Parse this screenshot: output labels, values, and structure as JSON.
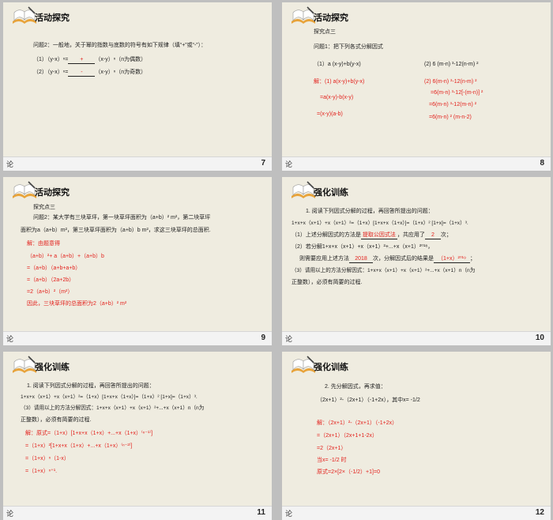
{
  "footer_left": "论",
  "slides": [
    {
      "num": "7",
      "title": "活动探究",
      "q": "问题2：一般地，关于幂的指数与底数的符号有如下规律（填“+”或“-”）：",
      "l1_a": "（1）（y-x）ⁿ=",
      "l1_blank": "+",
      "l1_b": "（x-y）ⁿ（n为偶数）",
      "l2_a": "（2）（y-x）ⁿ=",
      "l2_blank": "-",
      "l2_b": "（x-y）ⁿ（n为奇数）"
    },
    {
      "num": "8",
      "title": "活动探究",
      "sub": "探究点三",
      "q": "问题1：把下列各式分解因式",
      "p1": "（1）a (x-y)+b(y-x)",
      "p2": "(2) 6 (m-n) ³-12(n-m) ²",
      "s1a": "解：(1) a(x-y)+b(y-x)",
      "s1b": "=a(x-y)-b(x-y)",
      "s1c": "=(x-y)(a-b)",
      "s2a": "(2)  6(m-n) ³-12(n-m) ²",
      "s2b": "=6(m-n) ³-12[-(m-n)] ²",
      "s2c": "=6(m-n) ³-12(m-n) ²",
      "s2d": "=6(m-n) ² (m-n-2)"
    },
    {
      "num": "9",
      "title": "活动探究",
      "sub": "探究点三",
      "q1": "问题2：某大学有三块草坪，第一块草坪面积为（a+b）² m²，第二块草坪",
      "q2": "面积为a（a+b）m²，第三块草坪面积为（a+b）b  m²，求这三块草坪的总面积.",
      "s1": "解：由题意得",
      "s2": "（a+b）²+ a（a+b）+（a+b）b",
      "s3": "=（a+b）（a+b+a+b）",
      "s4": "=（a+b）（2a+2b）",
      "s5": "=2（a+b）²（m²）",
      "s6": "因此，三块草坪的总面积为2（a+b）²  m²"
    },
    {
      "num": "10",
      "title": "强化训练",
      "q": "1. 阅读下列因式分解的过程，再回答所提出的问题：",
      "e": "1+x+x（x+1）+x（x+1）²=（1+x）[1+x+x（1+x）]=（1+x）² [1+x]=（1+x）³.",
      "a1_a": "（1）上述分解因式的方法是",
      "a1_blank": "提取公因式法",
      "a1_b": "，共应用了",
      "a1_blank2": "2",
      "a1_c": "次；",
      "a2_a": "（2）若分解1+x+x（x+1）+x（x+1）²+...+x（x+1）²⁰¹⁸，",
      "a2_b": "则需要应用上述方法",
      "a2_blank": "2018",
      "a2_c": "次，分解因式后的结果是",
      "a2_blank2": "（1+x）²⁰¹⁹",
      "a2_d": "；",
      "a3": "（3）请用以上的方法分解因式：1+x+x（x+1）+x（x+1）²+...+x（x+1）n（n为",
      "a3b": "正整数），必须有简要的过程."
    },
    {
      "num": "11",
      "title": "强化训练",
      "q": "1. 阅读下列因式分解的过程，再回答所提出的问题：",
      "e": "1+x+x（x+1）+x（x+1）²=（1+x）[1+x+x（1+x）]=（1+x）² [1+x]=（1+x）³.",
      "a3": "（3）请用以上的方法分解因式：1+x+x（x+1）+x（x+1）²+...+x（x+1）n（n为",
      "a3b": "正整数），必须有简要的过程.",
      "s1": "解：原式=（1+x）[1+x+x（1+x）+...+x（1+x）⁽ⁿ⁻¹⁾]",
      "s2": "=（1+x）²[1+x+x（1+x）+...+x（1+x）⁽ⁿ⁻²⁾]",
      "s3": "=（1+x）ⁿ（1-x）",
      "s4": "=（1+x）ⁿ⁺¹."
    },
    {
      "num": "12",
      "title": "强化训练",
      "q": "2. 先分解因式，再求值：",
      "e": "（2x+1）²-（2x+1）（-1+2x），其中x= -1/2",
      "s1": "解：（2x+1）²-（2x+1）（-1+2x）",
      "s2": "=（2x+1）（2x+1+1-2x）",
      "s3": "=2（2x+1）",
      "s4": "当x= -1/2 时",
      "s5": "原式=2×[2×（-1/2）+1]=0"
    }
  ]
}
